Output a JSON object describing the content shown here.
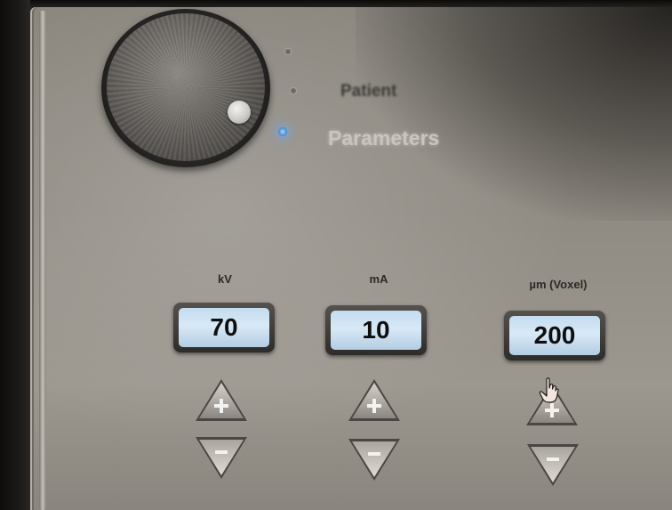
{
  "modes": [
    {
      "label": "Patient",
      "active": false
    },
    {
      "label": "Parameters",
      "active": true
    }
  ],
  "parameters": [
    {
      "label": "kV",
      "value": "70"
    },
    {
      "label": "mA",
      "value": "10"
    },
    {
      "label": "µm (Voxel)",
      "value": "200"
    }
  ],
  "controls": {
    "increment_symbol": "+",
    "decrement_symbol": "−"
  },
  "colors": {
    "panel": "#8f8a82",
    "display": "#c3dcef",
    "led_active": "#4f90d8"
  },
  "icons": [
    "dial-icon",
    "plus-icon",
    "minus-icon",
    "hand-pointer-icon"
  ]
}
